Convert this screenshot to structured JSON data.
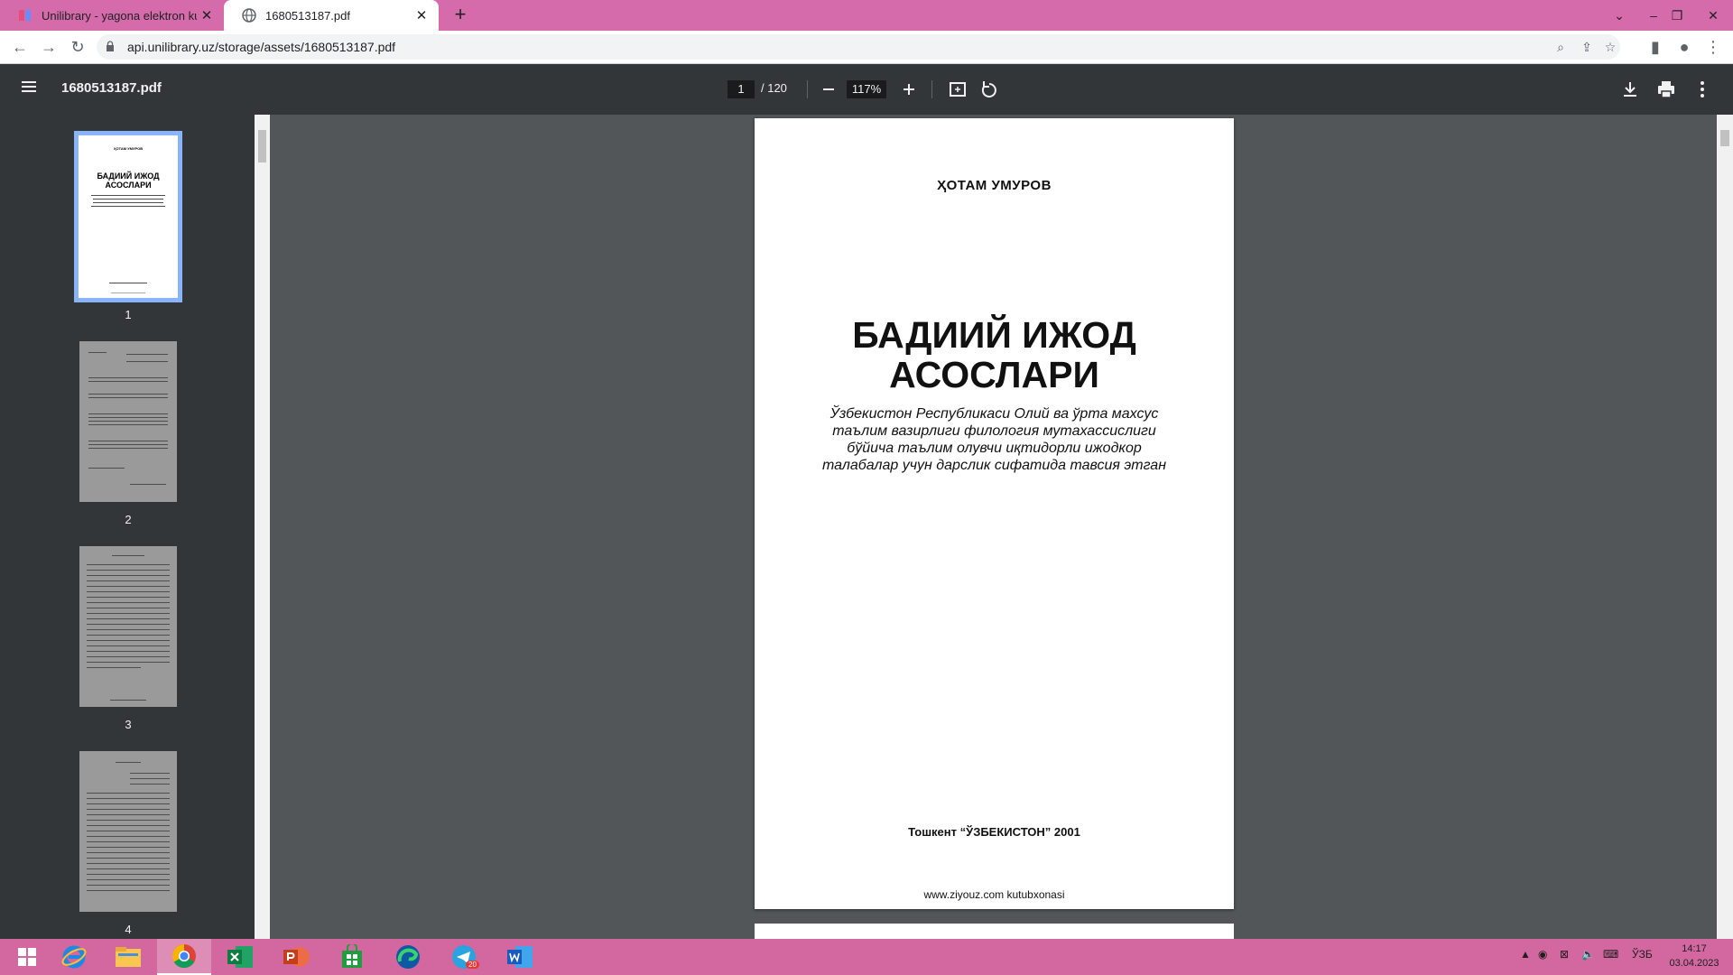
{
  "tabs": [
    {
      "title": "Unilibrary - yagona elektron kutubxona",
      "active": false
    },
    {
      "title": "1680513187.pdf",
      "active": true
    }
  ],
  "address": {
    "url": "api.unilibrary.uz/storage/assets/1680513187.pdf"
  },
  "pdf_toolbar": {
    "filename": "1680513187.pdf",
    "current_page": "1",
    "total_pages": "/ 120",
    "zoom": "117%"
  },
  "thumbnails": [
    {
      "number": "1"
    },
    {
      "number": "2"
    },
    {
      "number": "3"
    },
    {
      "number": "4"
    }
  ],
  "thumb1": {
    "author": "ҲОТАМ УМУРОВ",
    "title_line1": "БАДИИЙ ИЖОД",
    "title_line2": "АСОСЛАРИ"
  },
  "page": {
    "author": "ҲОТАМ УМУРОВ",
    "title_line1": "БАДИИЙ ИЖОД",
    "title_line2": "АСОСЛАРИ",
    "subtitle_line1": "Ўзбекистон Республикаси Олий ва ўрта махсус",
    "subtitle_line2": "таълим вазирлиги филология мутахассислиги",
    "subtitle_line3": "бўйича таълим олувчи иқтидорли ижодкор",
    "subtitle_line4": "талабалар учун дарслик сифатида тавсия этган",
    "publisher": "Тошкент “ЎЗБЕКИСТОН” 2001",
    "website": "www.ziyouz.com kutubxonasi"
  },
  "taskbar": {
    "language": "ЎЗБ",
    "time": "14:17",
    "date": "03.04.2023",
    "telegram_badge": "20"
  },
  "colors": {
    "tabstrip": "#d66bab",
    "pdf_toolbar": "#323639",
    "viewer_bg": "#525659",
    "taskbar": "#d3679f",
    "thumb_highlight": "#8ab4f8"
  }
}
